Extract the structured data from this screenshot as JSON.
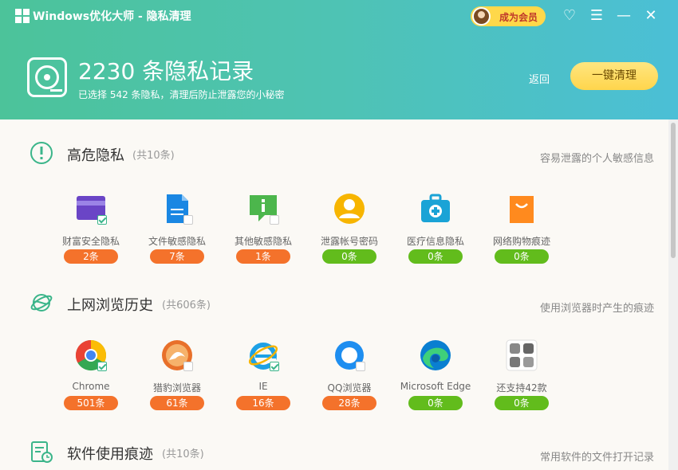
{
  "window": {
    "title": "Windows优化大师 - 隐私清理",
    "vip_label": "成为会员"
  },
  "summary": {
    "headline": "2230 条隐私记录",
    "subline": "已选择 542 条隐私，清理后防止泄露您的小秘密",
    "back_label": "返回",
    "clean_label": "一键清理"
  },
  "sections": [
    {
      "title": "高危隐私",
      "count": "(共10条)",
      "desc": "容易泄露的个人敏感信息",
      "items": [
        {
          "label": "财富安全隐私",
          "count": "2条",
          "status": "orange",
          "icon": "wallet-card-icon"
        },
        {
          "label": "文件敏感隐私",
          "count": "7条",
          "status": "orange",
          "icon": "document-icon"
        },
        {
          "label": "其他敏感隐私",
          "count": "1条",
          "status": "orange",
          "icon": "info-bubble-icon"
        },
        {
          "label": "泄露帐号密码",
          "count": "0条",
          "status": "green",
          "icon": "user-account-icon"
        },
        {
          "label": "医疗信息隐私",
          "count": "0条",
          "status": "green",
          "icon": "medical-kit-icon"
        },
        {
          "label": "网络购物痕迹",
          "count": "0条",
          "status": "green",
          "icon": "shopping-bag-icon"
        }
      ]
    },
    {
      "title": "上网浏览历史",
      "count": "(共606条)",
      "desc": "使用浏览器时产生的痕迹",
      "items": [
        {
          "label": "Chrome",
          "count": "501条",
          "status": "orange",
          "icon": "chrome-icon"
        },
        {
          "label": "猎豹浏览器",
          "count": "61条",
          "status": "orange",
          "icon": "cheetah-browser-icon"
        },
        {
          "label": "IE",
          "count": "16条",
          "status": "orange",
          "icon": "ie-icon"
        },
        {
          "label": "QQ浏览器",
          "count": "28条",
          "status": "orange",
          "icon": "qq-browser-icon"
        },
        {
          "label": "Microsoft Edge",
          "count": "0条",
          "status": "green",
          "icon": "edge-icon"
        },
        {
          "label": "还支持42款",
          "count": "0条",
          "status": "green",
          "icon": "more-browsers-icon"
        }
      ]
    },
    {
      "title": "软件使用痕迹",
      "count": "(共10条)",
      "desc": "常用软件的文件打开记录"
    }
  ]
}
